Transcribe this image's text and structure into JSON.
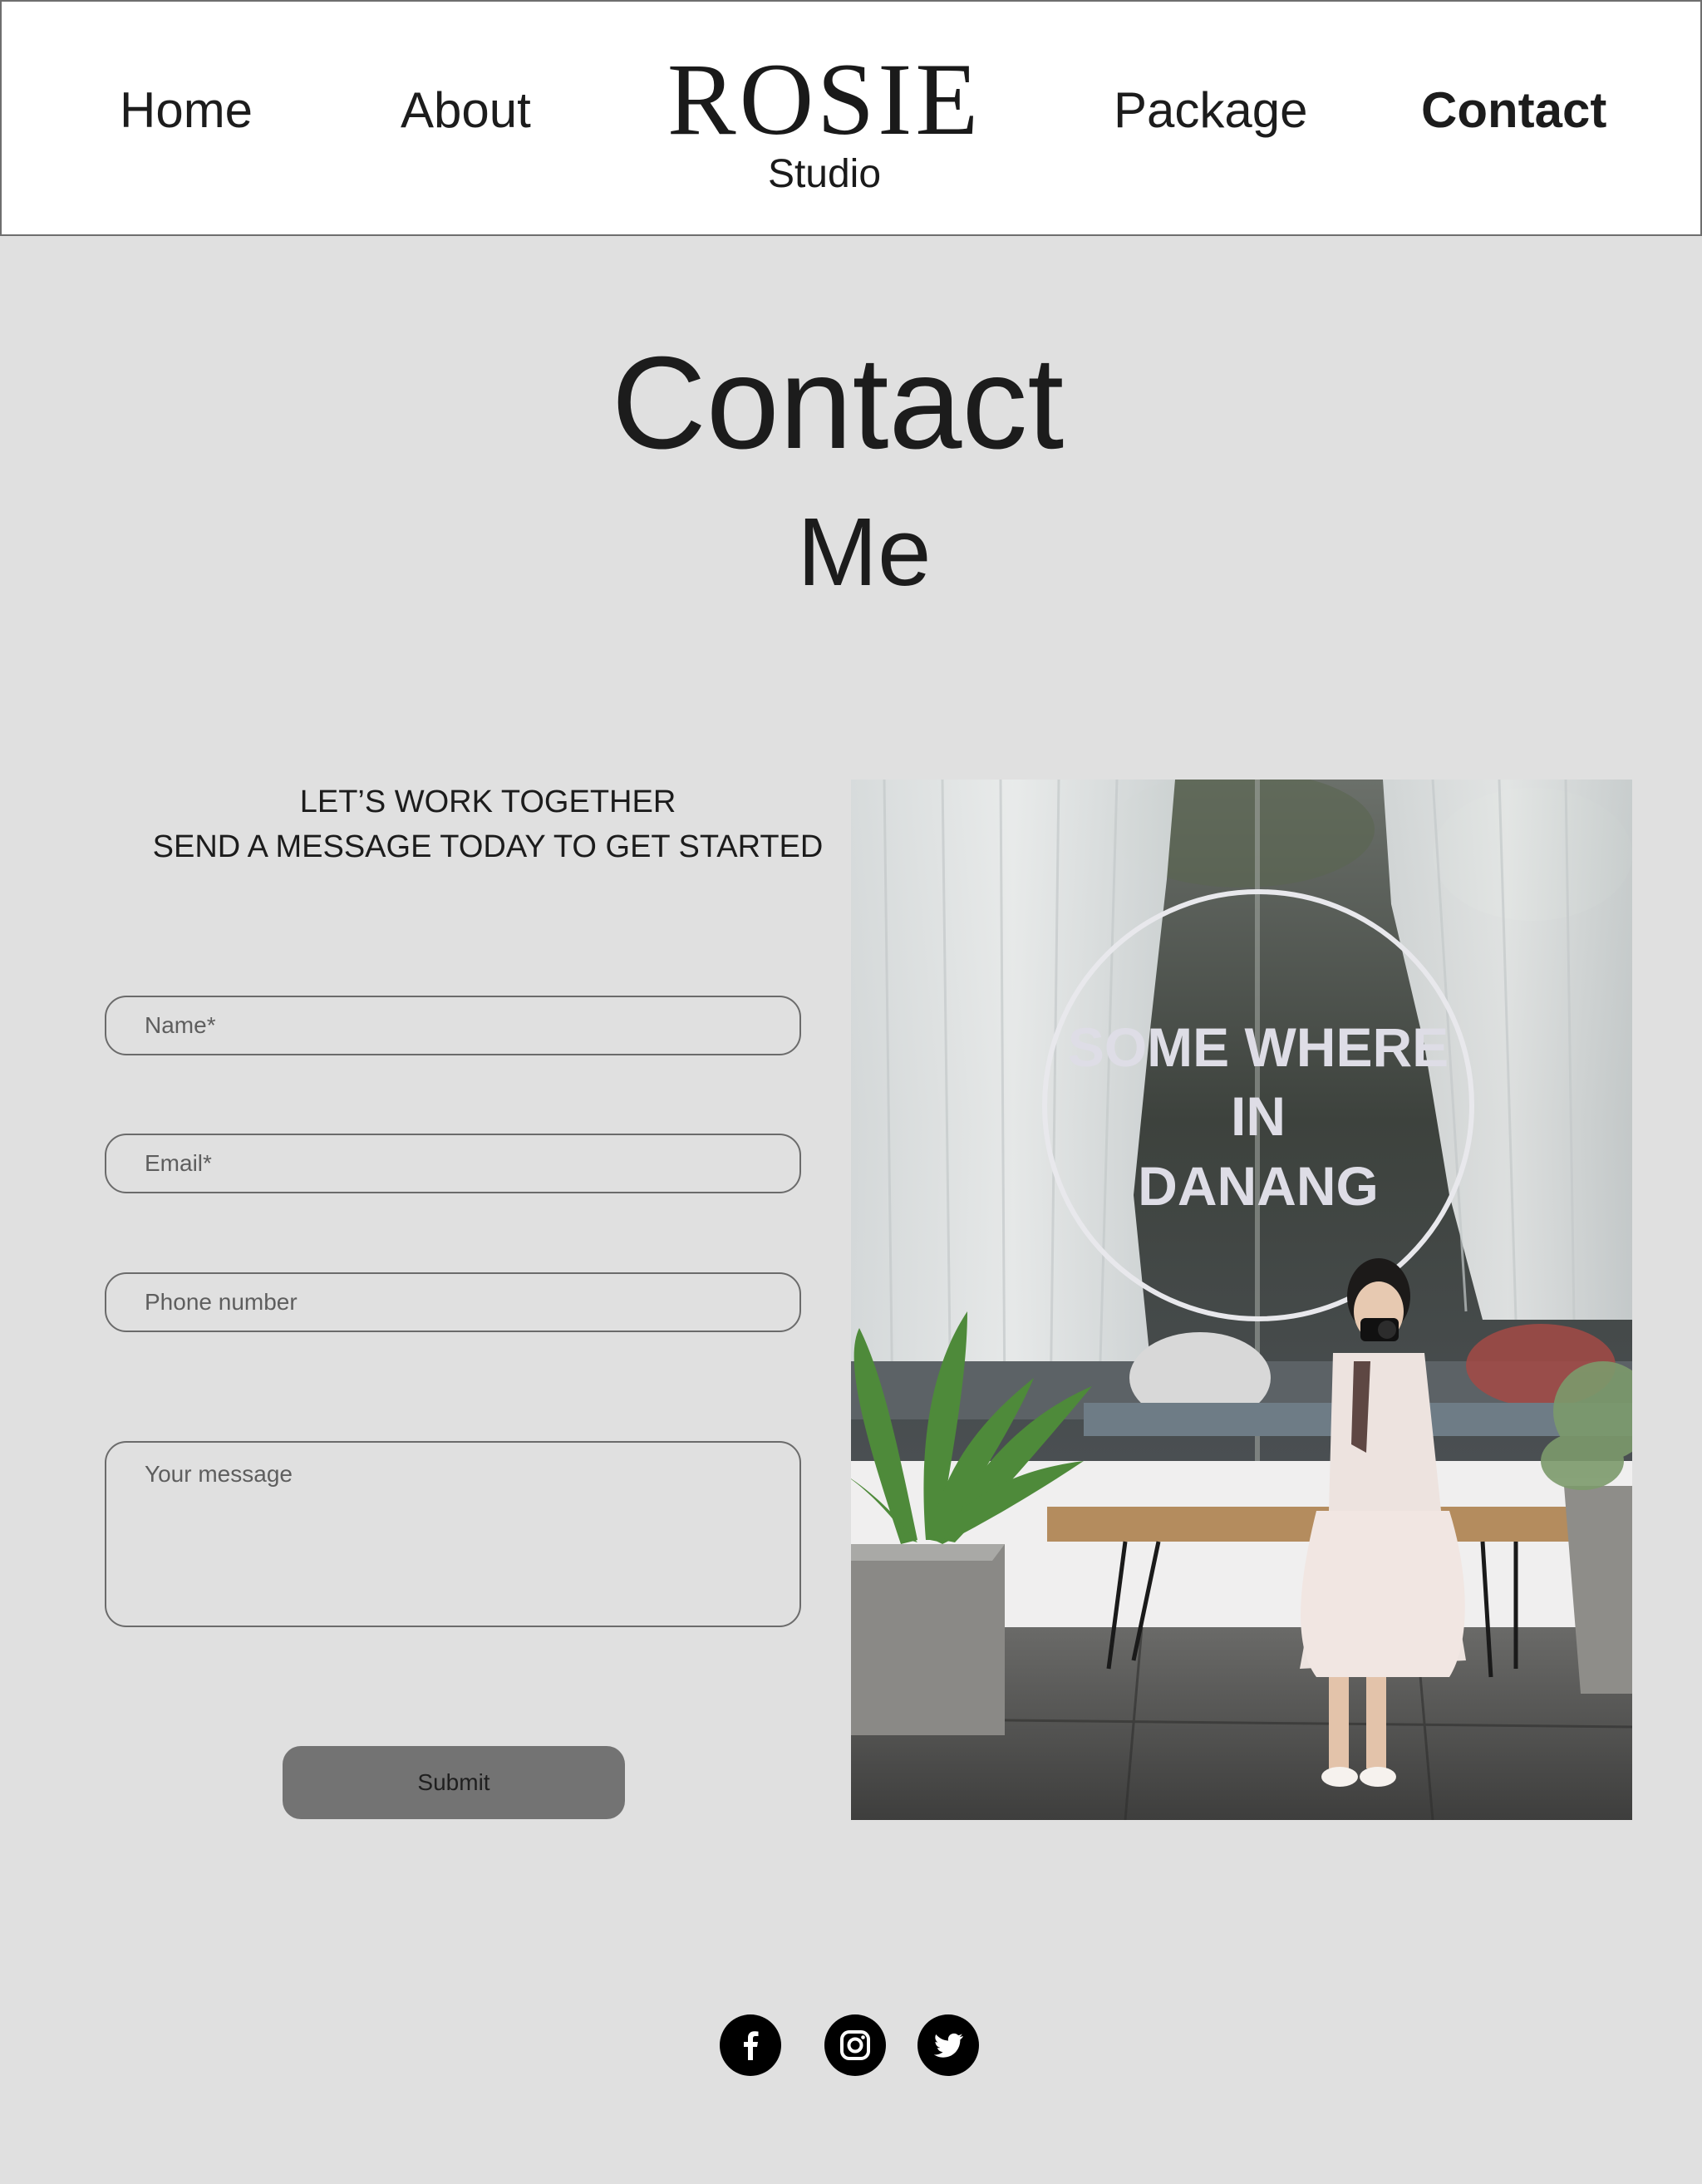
{
  "nav": {
    "home": "Home",
    "about": "About",
    "package": "Package",
    "contact": "Contact"
  },
  "logo": {
    "name": "ROSIE",
    "sub": "Studio"
  },
  "page_title": {
    "line1": "Contact",
    "line2": "Me"
  },
  "intro": {
    "line1": "LET’S WORK TOGETHER",
    "line2": "SEND A MESSAGE TODAY TO GET STARTED"
  },
  "form": {
    "name_placeholder": "Name*",
    "email_placeholder": "Email*",
    "phone_placeholder": "Phone number",
    "message_placeholder": "Your message",
    "submit_label": "Submit"
  },
  "photo": {
    "sign_line1": "SOME WHERE",
    "sign_line2": "IN",
    "sign_line3": "DANANG"
  },
  "social": [
    "facebook-icon",
    "instagram-icon",
    "twitter-icon"
  ],
  "colors": {
    "page_bg": "#e0e0e0",
    "header_bg": "#ffffff",
    "submit_bg": "#737373",
    "text": "#1c1c1c",
    "icon_bg": "#000000"
  }
}
